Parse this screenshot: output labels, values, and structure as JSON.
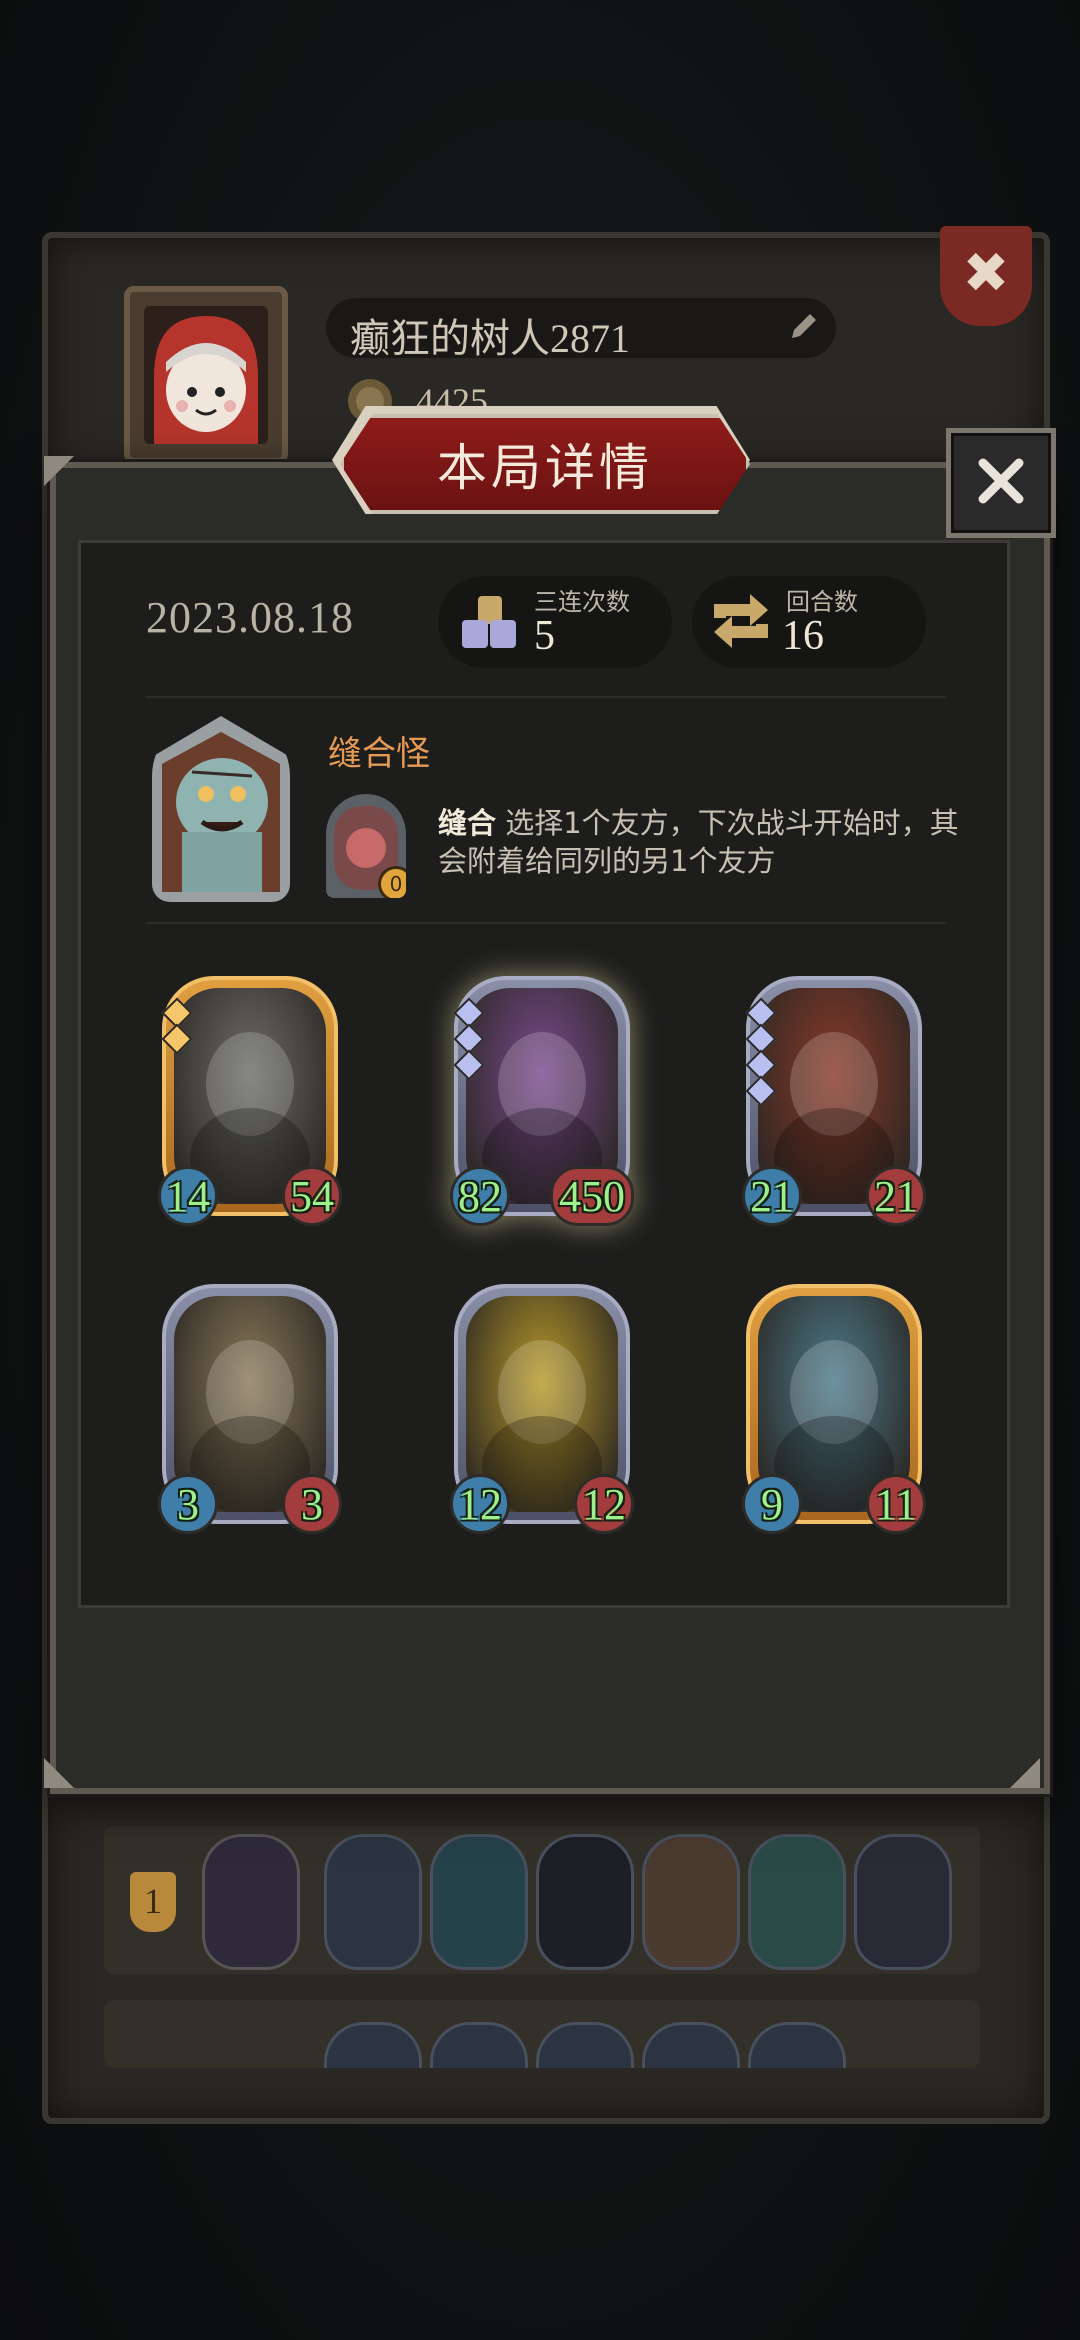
{
  "profile": {
    "name": "癫狂的树人2871",
    "gold": "4425"
  },
  "modal": {
    "title": "本局详情"
  },
  "stats": {
    "date": "2023.08.18",
    "triples_label": "三连次数",
    "triples_value": "5",
    "rounds_label": "回合数",
    "rounds_value": "16"
  },
  "hero": {
    "name": "缝合怪",
    "skill_name": "缝合",
    "skill_desc": "选择1个友方，下次战斗开始时，其会附着给同列的另1个友方",
    "skill_charges": "0"
  },
  "cards": [
    {
      "attack": "14",
      "health": "54",
      "frame": "gold",
      "tier": 2,
      "art_color": "#6d6d6a"
    },
    {
      "attack": "82",
      "health": "450",
      "frame": "silver",
      "tier": 3,
      "art_color": "#7a4b8e"
    },
    {
      "attack": "21",
      "health": "21",
      "frame": "silver",
      "tier": 4,
      "art_color": "#8a3a2a"
    },
    {
      "attack": "3",
      "health": "3",
      "frame": "silver",
      "tier": 0,
      "art_color": "#8a7a5a"
    },
    {
      "attack": "12",
      "health": "12",
      "frame": "silver",
      "tier": 0,
      "art_color": "#b89a2a"
    },
    {
      "attack": "9",
      "health": "11",
      "frame": "gold",
      "tier": 0,
      "art_color": "#4d7a8a"
    }
  ],
  "leaderboard": {
    "rank": "1"
  },
  "colors": {
    "banner_red": "#8f1c1a",
    "hero_name": "#e59a54",
    "stat_green": "#9ef08c",
    "attack_blue": "#3f7ea8",
    "health_red": "#a33c3c"
  }
}
